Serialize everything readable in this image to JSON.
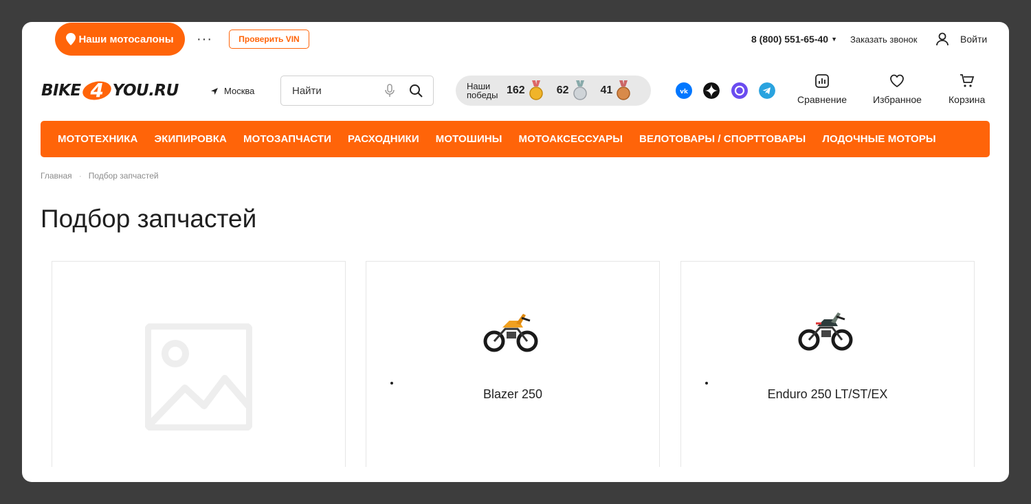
{
  "topbar": {
    "salons_label": "Наши мотосалоны",
    "more": "···",
    "vin_label": "Проверить VIN",
    "phone": "8 (800) 551-65-40",
    "callback": "Заказать звонок",
    "login": "Войти"
  },
  "header": {
    "logo_left": "BIKE",
    "logo_mid": "4",
    "logo_right": "YOU.RU",
    "city": "Москва",
    "search_placeholder": "Найти",
    "wins_label": "Наши победы",
    "gold": "162",
    "silver": "62",
    "bronze": "41",
    "compare": "Сравнение",
    "favorites": "Избранное",
    "cart": "Корзина"
  },
  "menu": {
    "items": [
      "МОТОТЕХНИКА",
      "ЭКИПИРОВКА",
      "МОТОЗАПЧАСТИ",
      "РАСХОДНИКИ",
      "МОТОШИНЫ",
      "МОТОАКСЕССУАРЫ",
      "ВЕЛОТОВАРЫ / СПОРТТОВАРЫ",
      "ЛОДОЧНЫЕ МОТОРЫ"
    ]
  },
  "breadcrumb": {
    "home": "Главная",
    "sep": "·",
    "current": "Подбор запчастей"
  },
  "page": {
    "title": "Подбор запчастей"
  },
  "cards": [
    {
      "name": ""
    },
    {
      "name": "Blazer 250"
    },
    {
      "name": "Enduro 250 LT/ST/EX"
    }
  ],
  "colors": {
    "brand": "#ff6409"
  }
}
